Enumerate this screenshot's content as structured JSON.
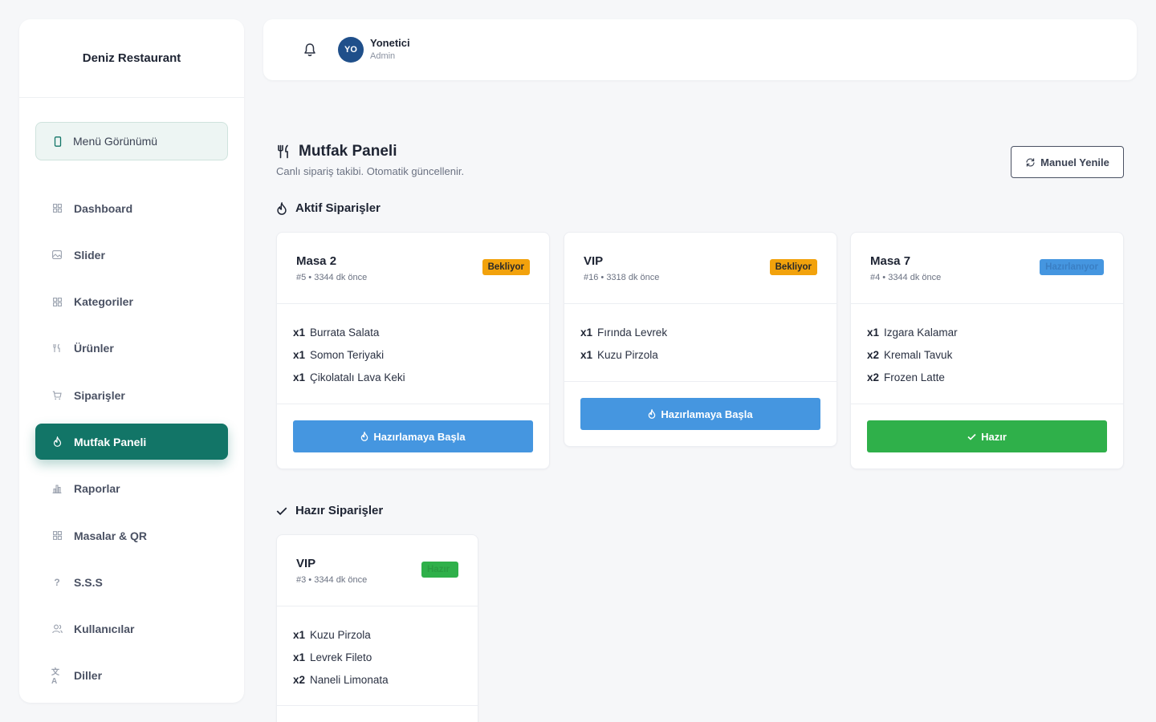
{
  "sidebar": {
    "brand": "Deniz Restaurant",
    "menu_view": "Menü Görünümü",
    "items": [
      {
        "label": "Dashboard",
        "icon": "grid-icon"
      },
      {
        "label": "Slider",
        "icon": "image-icon"
      },
      {
        "label": "Kategoriler",
        "icon": "grid-icon"
      },
      {
        "label": "Ürünler",
        "icon": "utensils-icon"
      },
      {
        "label": "Siparişler",
        "icon": "cart-icon"
      },
      {
        "label": "Mutfak Paneli",
        "icon": "flame-icon",
        "active": true
      },
      {
        "label": "Raporlar",
        "icon": "bar-chart-icon"
      },
      {
        "label": "Masalar & QR",
        "icon": "grid-icon"
      },
      {
        "label": "S.S.S",
        "icon": "question-icon"
      },
      {
        "label": "Kullanıcılar",
        "icon": "users-icon"
      },
      {
        "label": "Diller",
        "icon": "translate-icon"
      }
    ]
  },
  "topbar": {
    "avatar_initials": "YO",
    "user_name": "Yonetici",
    "user_role": "Admin"
  },
  "page": {
    "title": "Mutfak Paneli",
    "subtitle": "Canlı sipariş takibi. Otomatik güncellenir.",
    "refresh_label": "Manuel Yenile"
  },
  "active_section": {
    "title": "Aktif Siparişler",
    "orders": [
      {
        "name": "Masa 2",
        "meta": "#5 • 3344 dk önce",
        "status": "Bekliyor",
        "items": [
          {
            "qty": "x1",
            "name": "Burrata Salata"
          },
          {
            "qty": "x1",
            "name": "Somon Teriyaki"
          },
          {
            "qty": "x1",
            "name": "Çikolatalı Lava Keki"
          }
        ],
        "action": "Hazırlamaya Başla"
      },
      {
        "name": "VIP",
        "meta": "#16 • 3318 dk önce",
        "status": "Bekliyor",
        "items": [
          {
            "qty": "x1",
            "name": "Fırında Levrek"
          },
          {
            "qty": "x1",
            "name": "Kuzu Pirzola"
          }
        ],
        "action": "Hazırlamaya Başla"
      },
      {
        "name": "Masa 7",
        "meta": "#4 • 3344 dk önce",
        "status": "Hazırlanıyor",
        "items": [
          {
            "qty": "x1",
            "name": "Izgara Kalamar"
          },
          {
            "qty": "x2",
            "name": "Kremalı Tavuk"
          },
          {
            "qty": "x2",
            "name": "Frozen Latte"
          }
        ],
        "action": "Hazır"
      }
    ]
  },
  "ready_section": {
    "title": "Hazır Siparişler",
    "orders": [
      {
        "name": "VIP",
        "meta": "#3 • 3344 dk önce",
        "status": "Hazır",
        "items": [
          {
            "qty": "x1",
            "name": "Kuzu Pirzola"
          },
          {
            "qty": "x1",
            "name": "Levrek Fileto"
          },
          {
            "qty": "x2",
            "name": "Naneli Limonata"
          }
        ]
      }
    ]
  },
  "colors": {
    "primary": "#127567",
    "waiting": "#f2a20c",
    "preparing": "#4596e0",
    "ready": "#2fb04a",
    "action_blue": "#4596e0",
    "action_green": "#2fb04a"
  }
}
